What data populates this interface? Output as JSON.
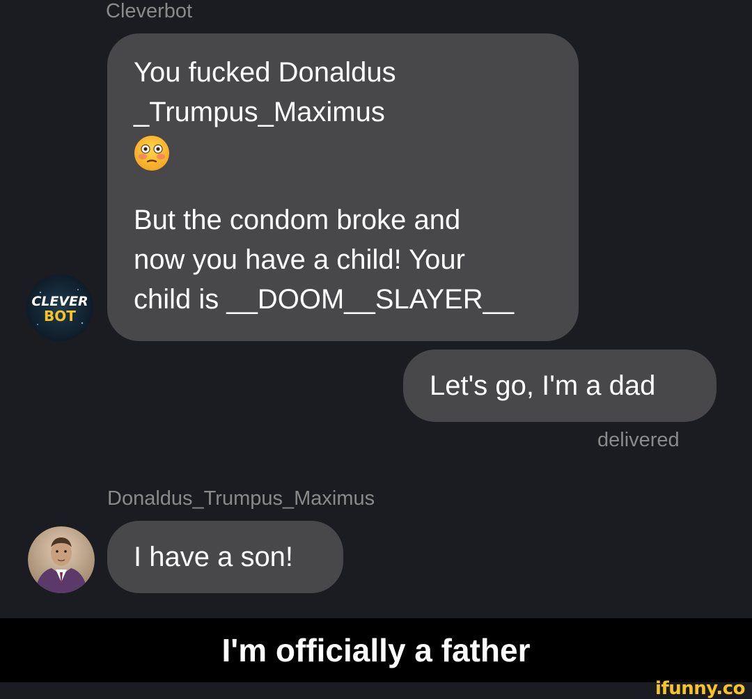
{
  "thread": {
    "cleverbot_sender": "Cleverbot",
    "cleverbot_message": {
      "line1": "You fucked Donaldus",
      "line2": "_Trumpus_Maximus",
      "emoji": "flushed-face-emoji",
      "line3": "But the condom broke and",
      "line4": "now you have a child! Your",
      "line5": "child is __DOOM__SLAYER__"
    },
    "user_reply": "Let's go, I'm a dad",
    "reply_status": "delivered",
    "donaldus_sender": "Donaldus_Trumpus_Maximus",
    "donaldus_message": "I have a son!"
  },
  "avatars": {
    "cleverbot_logo": {
      "line1": "CLEVER",
      "line2": "BOT"
    },
    "donaldus": "person-avatar-icon"
  },
  "caption": "I'm officially a father",
  "watermark": "ifunny.co",
  "colors": {
    "background": "#1b1c21",
    "bubble": "#48484b",
    "meta_text": "#8a8a8a",
    "caption_bar": "#000000",
    "watermark": "#f7c325"
  }
}
